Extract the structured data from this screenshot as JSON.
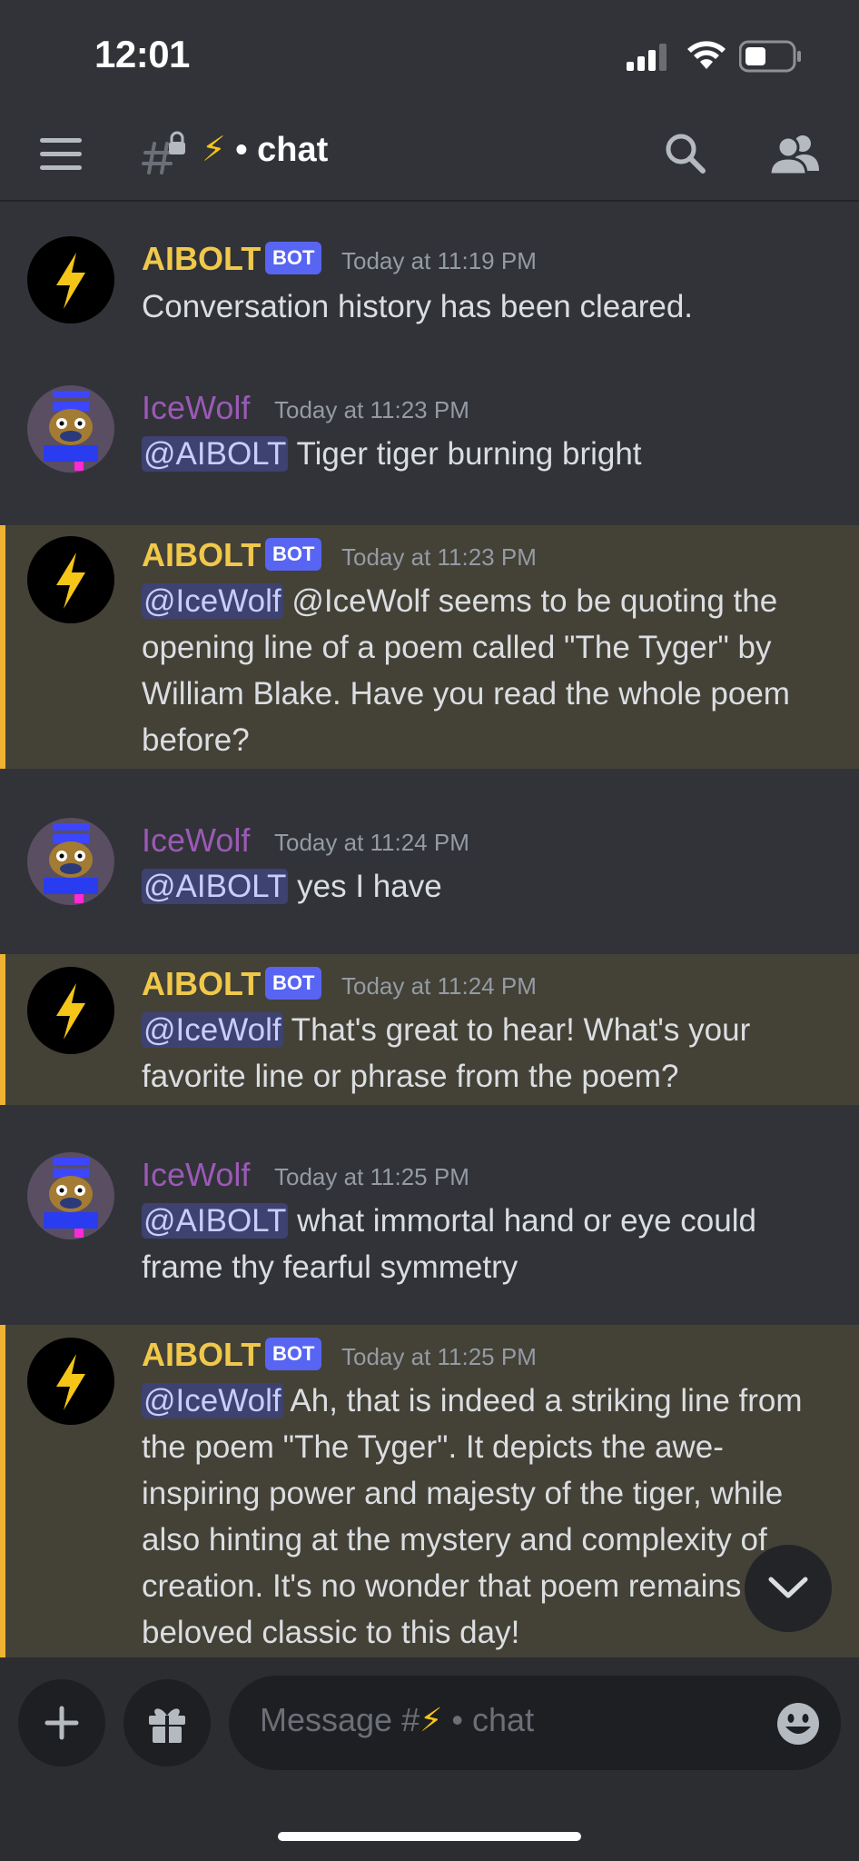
{
  "status_bar": {
    "time": "12:01"
  },
  "header": {
    "channel_emoji": "⚡",
    "channel_separator": "•",
    "channel_label": "chat"
  },
  "messages": [
    {
      "author": "AIBOLT",
      "bot_tag": "BOT",
      "timestamp": "Today at 11:19 PM",
      "text": "Conversation history has been cleared."
    },
    {
      "author": "IceWolf",
      "timestamp": "Today at 11:23 PM",
      "mention": "@AIBOLT",
      "text": " Tiger tiger burning bright"
    },
    {
      "author": "AIBOLT",
      "bot_tag": "BOT",
      "timestamp": "Today at 11:23 PM",
      "mention": "@IceWolf",
      "text": " @IceWolf seems to be quoting the opening line of a poem called \"The Tyger\" by William Blake. Have you read the whole poem before?"
    },
    {
      "author": "IceWolf",
      "timestamp": "Today at 11:24 PM",
      "mention": "@AIBOLT",
      "text": " yes I have"
    },
    {
      "author": "AIBOLT",
      "bot_tag": "BOT",
      "timestamp": "Today at 11:24 PM",
      "mention": "@IceWolf",
      "text": " That's great to hear! What's your favorite line or phrase from the poem?"
    },
    {
      "author": "IceWolf",
      "timestamp": "Today at 11:25 PM",
      "mention": "@AIBOLT",
      "text": " what immortal hand or eye could frame thy fearful symmetry"
    },
    {
      "author": "AIBOLT",
      "bot_tag": "BOT",
      "timestamp": "Today at 11:25 PM",
      "mention": "@IceWolf",
      "text": " Ah, that is indeed a striking line from the poem \"The Tyger\". It depicts the awe-inspiring power and majesty of the tiger, while also hinting at the mystery and complexity of creation. It's no wonder that poem remains a beloved classic to this day!"
    }
  ],
  "composer": {
    "placeholder_prefix": "Message #",
    "placeholder_emoji": "⚡",
    "placeholder_sep": "•",
    "placeholder_channel": "chat"
  },
  "colors": {
    "background": "#313338",
    "bot_name": "#f0c94b",
    "user_name": "#9b59b6",
    "bot_tag": "#5865f2",
    "highlight_bg": "#444137",
    "highlight_bar": "#f0b232",
    "mention_bg": "#3d4270"
  },
  "icons": [
    "hamburger-icon",
    "channel-hash-lock-icon",
    "search-icon",
    "members-icon",
    "plus-icon",
    "gift-icon",
    "emoji-icon",
    "chevron-down-icon",
    "lightning-bolt-icon"
  ]
}
